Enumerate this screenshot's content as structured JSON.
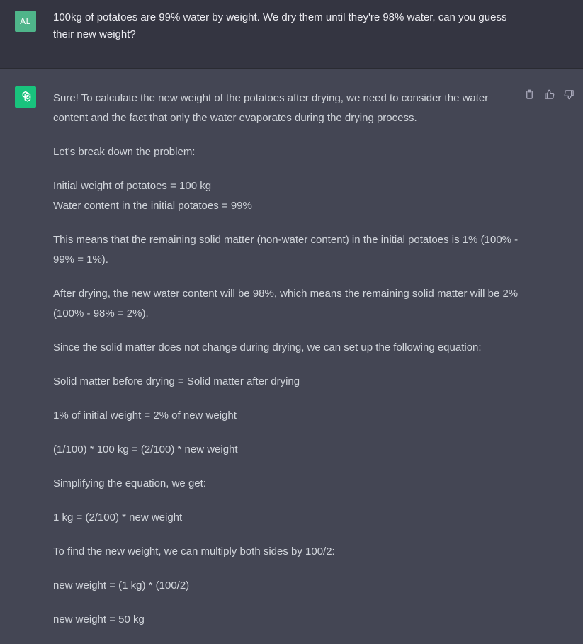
{
  "user": {
    "avatar_initials": "AL",
    "message": "100kg of potatoes are 99% water by weight. We dry them until they're 98% water, can you guess their new weight?"
  },
  "assistant": {
    "avatar_icon": "openai-logo-icon",
    "actions": {
      "copy_icon": "clipboard-icon",
      "like_icon": "thumbs-up-icon",
      "dislike_icon": "thumbs-down-icon"
    },
    "paragraphs": [
      "Sure! To calculate the new weight of the potatoes after drying, we need to consider the water content and the fact that only the water evaporates during the drying process.",
      "Let's break down the problem:",
      "Initial weight of potatoes = 100 kg",
      "Water content in the initial potatoes = 99%",
      "This means that the remaining solid matter (non-water content) in the initial potatoes is 1% (100% - 99% = 1%).",
      "After drying, the new water content will be 98%, which means the remaining solid matter will be 2% (100% - 98% = 2%).",
      "Since the solid matter does not change during drying, we can set up the following equation:",
      "Solid matter before drying = Solid matter after drying",
      "1% of initial weight = 2% of new weight",
      "(1/100) * 100 kg = (2/100) * new weight",
      "Simplifying the equation, we get:",
      "1 kg = (2/100) * new weight",
      "To find the new weight, we can multiply both sides by 100/2:",
      "new weight = (1 kg) * (100/2)",
      "new weight = 50 kg"
    ]
  },
  "colors": {
    "user_bg": "#343541",
    "assistant_bg": "#444654",
    "user_avatar": "#4fb58a",
    "bot_avatar": "#19c37d"
  }
}
